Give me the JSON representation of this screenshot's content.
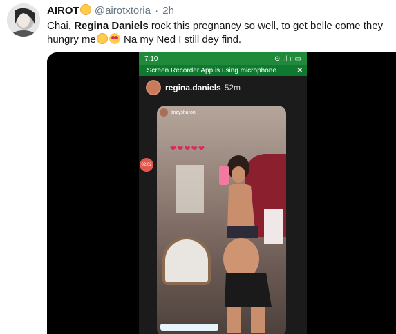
{
  "tweet": {
    "display_name": "AIROT",
    "handle": "@airotxtoria",
    "separator": "·",
    "time": "2h",
    "text_before": "Chai, ",
    "mention": "Regina Daniels",
    "text_middle": " rock this pregnancy so well, to get belle come they hungry me",
    "text_after": " Na my Ned I still dey find."
  },
  "video": {
    "status_time": "7:10",
    "status_icons": "⊙ .ıl ıl ▭",
    "recorder_notice": "..Screen Recorder App is using microphone",
    "recorder_close": "✕",
    "live_user": "regina.daniels",
    "live_ago": "52m",
    "story_user": "tinzysharon",
    "hearts": "❤❤❤❤❤",
    "rec_badge": "02:02"
  },
  "icons": {
    "name_emoji": "smiling-face-with-hearts-icon",
    "emoji_1": "smiling-face-with-hearts-icon",
    "emoji_2": "heart-eyes-icon"
  }
}
